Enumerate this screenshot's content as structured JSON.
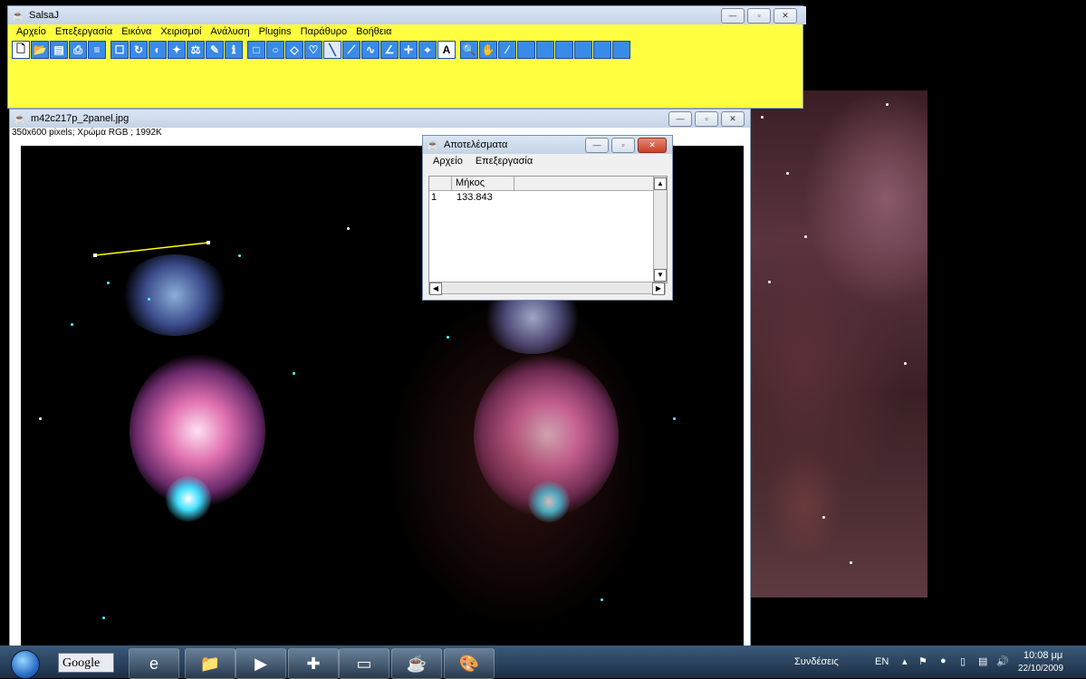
{
  "main_window": {
    "title": "SalsaJ",
    "menu": [
      "Αρχείο",
      "Επεξεργασία",
      "Εικόνα",
      "Χειρισμοί",
      "Ανάλυση",
      "Plugins",
      "Παράθυρο",
      "Βοήθεια"
    ]
  },
  "image_window": {
    "title": "m42c217p_2panel.jpg",
    "info": "350x600 pixels; Χρώμα RGB ; 1992K"
  },
  "results_window": {
    "title": "Αποτελέσματα",
    "menu": [
      "Αρχείο",
      "Επεξεργασία"
    ],
    "column_header": "Μήκος",
    "row_index": "1",
    "row_value": "133.843"
  },
  "taskbar": {
    "search_label": "Google",
    "tray_label": "Συνδέσεις",
    "language": "EN",
    "time": "10:08 μμ",
    "date": "22/10/2009"
  },
  "colors": {
    "salsaj_yellow": "#ffff40",
    "toolbar_blue": "#3a8ae8",
    "measure_line": "#ffff00"
  }
}
